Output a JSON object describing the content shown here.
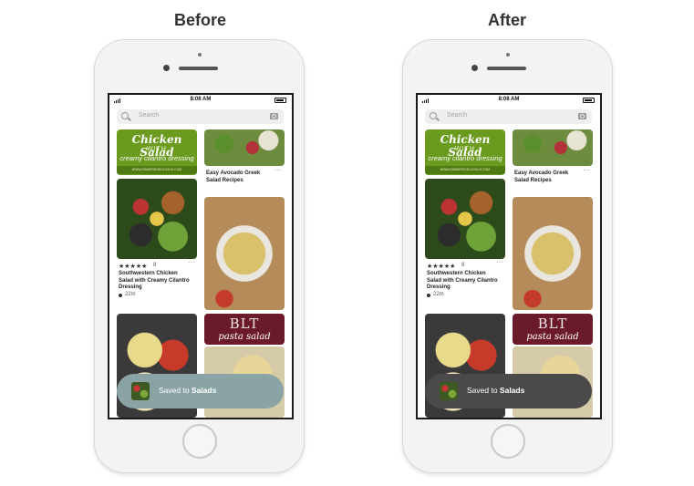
{
  "labels": {
    "before": "Before",
    "after": "After"
  },
  "phones": [
    {
      "id": "before",
      "toast_color": "#8aa4a6"
    },
    {
      "id": "after",
      "toast_color": "#4a4a4a"
    }
  ],
  "status": {
    "time": "8:08 AM"
  },
  "search": {
    "placeholder": "Search"
  },
  "pins": {
    "chicken_salad": {
      "title": "Chicken Salad",
      "with": "WITH",
      "dressing": "creamy cilantro dressing",
      "url": "WWW.DINNERSDELICIOUS.COM"
    },
    "bowl": {
      "stars": "★★★★★",
      "rating_count": "8",
      "title": "Southwestern Chicken Salad with Creamy Cilantro Dressing",
      "time": "22m"
    },
    "avocado": {
      "title": "Easy Avocado Greek Salad Recipes"
    },
    "blt": {
      "line1": "BLT",
      "line2": "pasta salad"
    }
  },
  "toast": {
    "prefix": "Saved to ",
    "board": "Salads"
  },
  "menu_dots": "···"
}
